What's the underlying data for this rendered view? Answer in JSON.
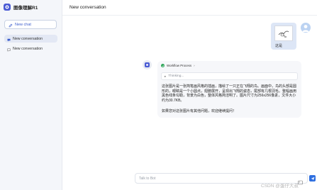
{
  "app": {
    "name": "图像理解R1",
    "brand_color": "#4a5bd4",
    "accent_color": "#3b5ccc"
  },
  "sidebar": {
    "new_chat_label": "New chat",
    "new_chat_icon": "edit-icon",
    "conversations": [
      {
        "label": "New conversation",
        "active": true,
        "icon": "chat-bubble-icon"
      },
      {
        "label": "New conversation",
        "active": false,
        "icon": "chat-bubble-icon"
      }
    ]
  },
  "header": {
    "title": "New conversation"
  },
  "messages": {
    "user": {
      "image_caption": "这是",
      "image_icon": "sketch-image-thumbnail"
    },
    "bot": {
      "workflow_label": "Workflow Process",
      "workflow_chevron": "›",
      "workflow_status_icon": "check-circle-icon",
      "thinking_label": "Thinking...",
      "thinking_arrow": "▸",
      "answer_paragraphs": [
        "这张图片是一张简笔画风格的插画，描绘了一只正在飞翔的鸟。画面中，鸟的头部是圆形的，眼睛是一个小圆点，翅膀展开，呈现出飞翔的姿态，尾部有几根羽毛。整幅画用黑色线条勾勒，背景为白色，整体风格简洁明了。图片尺寸为256x256像素，文件大小约为30.7KB。",
        "如果您对这张图片有其他问题，欢迎继续提问！"
      ]
    }
  },
  "input": {
    "placeholder": "Talk to Bot"
  },
  "watermark": {
    "text": "CSDN @蛋仔大叔"
  }
}
